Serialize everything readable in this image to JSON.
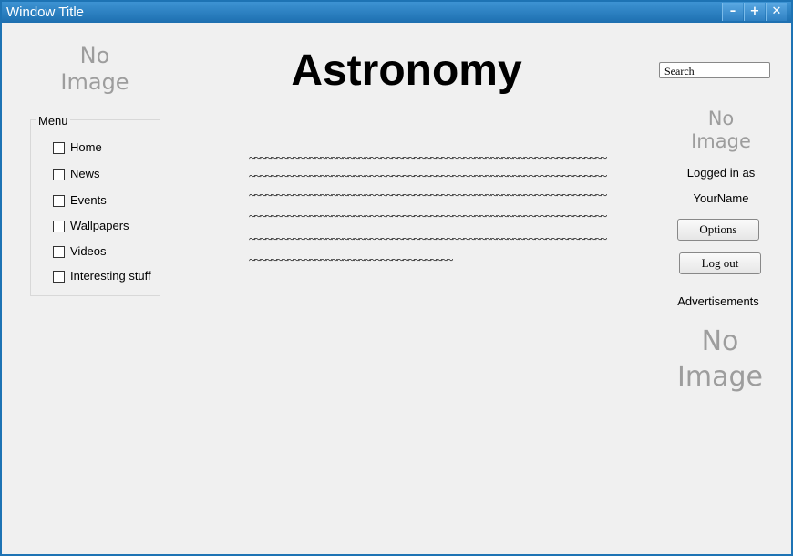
{
  "window": {
    "title": "Window Title",
    "minimize_label": "–",
    "maximize_label": "+",
    "close_label": "✕"
  },
  "logo_placeholder": {
    "line1": "No",
    "line2": "Image"
  },
  "heading": "Astronomy",
  "menu": {
    "legend": "Menu",
    "items": [
      {
        "label": "Home"
      },
      {
        "label": "News"
      },
      {
        "label": "Events"
      },
      {
        "label": "Wallpapers"
      },
      {
        "label": "Videos"
      },
      {
        "label": "Interesting stuff"
      }
    ]
  },
  "body_text": {
    "lines": [
      "~~~~~~~~~~~~~~~~~~~~~~~~~~~~~~~~~~~~~~~~~~~~~~~~~~~~~~~~~~~~~~~~~",
      "~~~~~~~~~~~~~~~~~~~~~~~~~~~~~~~~~~~~~~~~~~~~~~~~~~~~~~~~~~~~~~~~~",
      "~~~~~~~~~~~~~~~~~~~~~~~~~~~~~~~~~~~~~~~~~~~~~~~~~~~~~~~~~~~~~~~~~",
      "~~~~~~~~~~~~~~~~~~~~~~~~~~~~~~~~~~~~~~~~~~~~~~~~~~~~~~~~~~~~~~~~~",
      "~~~~~~~~~~~~~~~~~~~~~~~~~~~~~~~~~~~~~~~~~~~~~~~~~~~~~~~~~~~~~~~~~",
      "~~~~~~~~~~~~~~~~~~~~~~~~~~~~~~~~~~~~~"
    ]
  },
  "search": {
    "placeholder": "Search"
  },
  "user_panel": {
    "avatar_placeholder": {
      "line1": "No",
      "line2": "Image"
    },
    "logged_in_label": "Logged in as",
    "username": "YourName",
    "options_label": "Options",
    "logout_label": "Log out"
  },
  "ads": {
    "label": "Advertisements",
    "placeholder": {
      "line1": "No",
      "line2": "Image"
    }
  }
}
